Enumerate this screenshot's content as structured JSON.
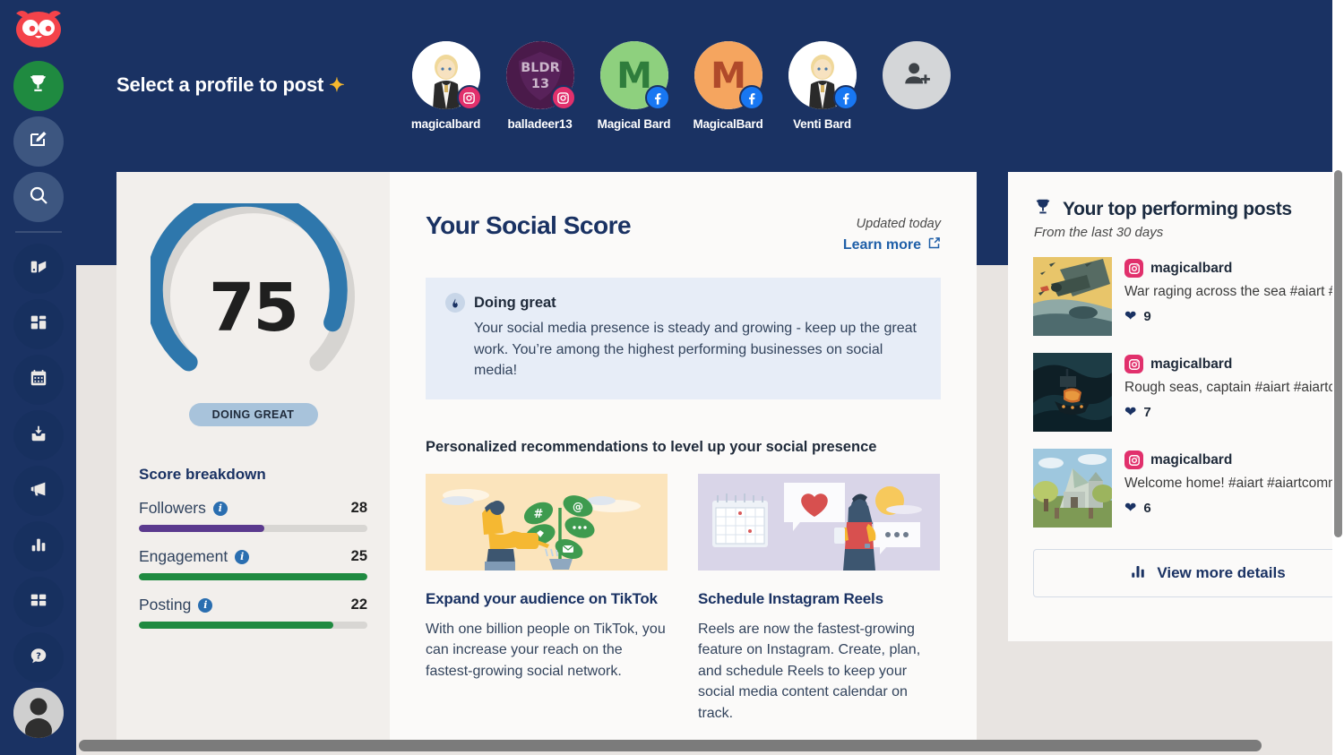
{
  "brand": {
    "accent_dark": "#1a3263",
    "accent_blue": "#2e77ac",
    "green": "#1f8a40",
    "purple": "#5b3a8e",
    "instagram": "#e1306c",
    "facebook": "#1877f2"
  },
  "rail": {
    "items": [
      {
        "name": "owl-logo",
        "icon": "owl-icon",
        "label": "Hootsuite"
      },
      {
        "name": "rewards",
        "icon": "trophy-icon",
        "label": "Rewards"
      },
      {
        "name": "compose",
        "icon": "compose-icon",
        "label": "Compose"
      },
      {
        "name": "search",
        "icon": "search-icon",
        "label": "Search"
      },
      {
        "name": "streams",
        "icon": "streams-icon",
        "label": "Streams"
      },
      {
        "name": "planner",
        "icon": "grid-icon",
        "label": "Planner"
      },
      {
        "name": "calendar",
        "icon": "calendar-icon",
        "label": "Calendar"
      },
      {
        "name": "inbox",
        "icon": "inbox-icon",
        "label": "Inbox"
      },
      {
        "name": "advertise",
        "icon": "megaphone-icon",
        "label": "Advertise"
      },
      {
        "name": "analytics",
        "icon": "bar-chart-icon",
        "label": "Analytics"
      },
      {
        "name": "apps",
        "icon": "apps-grid-icon",
        "label": "Apps"
      },
      {
        "name": "help",
        "icon": "question-icon",
        "label": "Help"
      },
      {
        "name": "account",
        "icon": "avatar-icon",
        "label": "Account"
      }
    ]
  },
  "header": {
    "title": "Select a profile to post",
    "sparkle": "✦",
    "profiles": [
      {
        "name": "magicalbard",
        "network": "instagram",
        "avatar_kind": "anime-blonde",
        "avatar_bg": "#ffffff"
      },
      {
        "name": "balladeer13",
        "network": "instagram",
        "avatar_kind": "bldr-crest",
        "avatar_bg": "#4a1a4a",
        "avatar_text": "BLDR",
        "avatar_text2": "13"
      },
      {
        "name": "Magical Bard",
        "network": "facebook",
        "avatar_kind": "letter",
        "avatar_bg": "#8ed07e",
        "avatar_text": "M"
      },
      {
        "name": "MagicalBard",
        "network": "facebook",
        "avatar_kind": "letter",
        "avatar_bg": "#f5a55f",
        "avatar_text": "M"
      },
      {
        "name": "Venti Bard",
        "network": "facebook",
        "avatar_kind": "anime-blonde",
        "avatar_bg": "#ffffff"
      }
    ],
    "add_profile_label": "Add a social network"
  },
  "score_panel": {
    "score": "75",
    "score_pct": 75,
    "status_pill": "DOING GREAT",
    "breakdown_title": "Score breakdown",
    "info_glyph": "i",
    "rows": [
      {
        "label": "Followers",
        "value": "28",
        "pct": 55,
        "color": "#5b3a8e"
      },
      {
        "label": "Engagement",
        "value": "25",
        "pct": 100,
        "color": "#1f8a40"
      },
      {
        "label": "Posting",
        "value": "22",
        "pct": 85,
        "color": "#1f8a40"
      }
    ]
  },
  "main": {
    "title": "Your Social Score",
    "updated": "Updated today",
    "learn_more": "Learn more",
    "external_link_icon": "external-link-icon",
    "callout": {
      "icon": "flame-icon",
      "title": "Doing great",
      "body": "Your social media presence is steady and growing - keep up the great work. You’re among the highest performing businesses on social media!"
    },
    "recs_title": "Personalized recommendations to level up your social presence",
    "recommendations": [
      {
        "heading": "Expand your audience on TikTok",
        "body": "With one billion people on TikTok, you can increase your reach on the fastest-growing social network.",
        "illustration": "person-watering-plant",
        "illustration_bg": "#fbe4bc"
      },
      {
        "heading": "Schedule Instagram Reels",
        "body": "Reels are now the fastest-growing feature on Instagram. Create, plan, and schedule Reels to keep your social media content calendar on track.",
        "illustration": "person-with-phone-calendar",
        "illustration_bg": "#d9d5e8"
      }
    ]
  },
  "right_panel": {
    "icon": "trophy-icon",
    "title": "Your top performing posts",
    "subtitle": "From the last 30 days",
    "posts": [
      {
        "network": "instagram",
        "username": "magicalbard",
        "text": "War raging across the sea #aiart #ai",
        "likes": "9",
        "thumb": "warplane-over-sea"
      },
      {
        "network": "instagram",
        "username": "magicalbard",
        "text": "Rough seas, captain #aiart #aiartco.",
        "likes": "7",
        "thumb": "ship-in-storm"
      },
      {
        "network": "instagram",
        "username": "magicalbard",
        "text": "Welcome home! #aiart #aiartcomm",
        "likes": "6",
        "thumb": "fantasy-mansion"
      }
    ],
    "view_more": "View more details",
    "view_more_icon": "bar-chart-icon"
  }
}
